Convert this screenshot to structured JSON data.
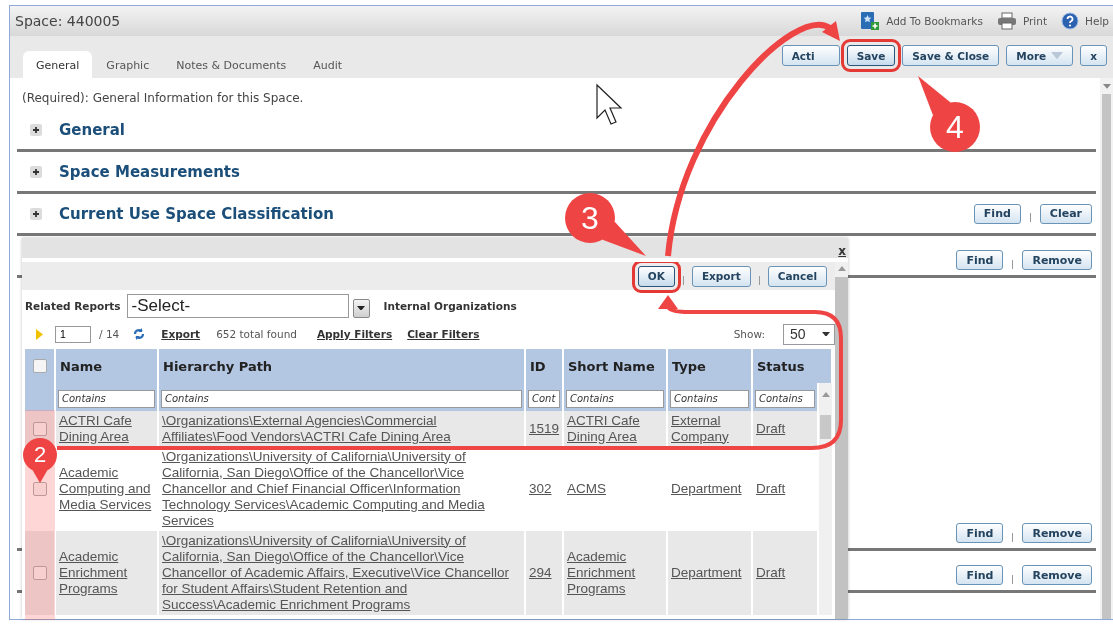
{
  "window": {
    "title": "Space: 440005"
  },
  "header_links": [
    {
      "kind": "bookmark",
      "label": "Add To Bookmarks"
    },
    {
      "kind": "print",
      "label": "Print"
    },
    {
      "kind": "help",
      "label": "Help"
    }
  ],
  "tabs": [
    {
      "label": "General",
      "selected": true
    },
    {
      "label": "Graphic",
      "selected": false
    },
    {
      "label": "Notes & Documents",
      "selected": false
    },
    {
      "label": "Audit",
      "selected": false
    }
  ],
  "toolbar_buttons": [
    {
      "label": "Acti",
      "highlighted": false,
      "dropdown": false
    },
    {
      "label": "Save",
      "highlighted": true,
      "dropdown": false
    },
    {
      "label": "Save & Close",
      "highlighted": false,
      "dropdown": false
    },
    {
      "label": "More",
      "highlighted": false,
      "dropdown": true
    },
    {
      "label": "x",
      "highlighted": false,
      "dropdown": false
    }
  ],
  "intro": "(Required): General Information for this Space.",
  "sections": [
    {
      "title": "General",
      "expanded": false
    },
    {
      "title": "Space Measurements",
      "expanded": false
    },
    {
      "title": "Current Use Space Classification",
      "expanded": false,
      "buttons": [
        "Find",
        "Clear"
      ]
    }
  ],
  "lower_rows": [
    {
      "buttons": [
        "Find",
        "Remove"
      ]
    },
    {
      "buttons": [
        "Find",
        "Remove"
      ]
    },
    {
      "buttons": [
        "Find",
        "Remove"
      ]
    }
  ],
  "dialog": {
    "close": "x",
    "buttons": [
      {
        "label": "OK",
        "highlighted": true
      },
      {
        "label": "Export",
        "highlighted": false
      },
      {
        "label": "Cancel",
        "highlighted": false
      }
    ],
    "related_reports": {
      "label": "Related Reports",
      "value": "-Select-"
    },
    "entity": "Internal Organizations",
    "pager": {
      "page": "1",
      "pages": "/ 14",
      "export": "Export",
      "total": "652 total found",
      "apply": "Apply Filters",
      "clear": "Clear Filters",
      "show_label": "Show:",
      "show_value": "50"
    },
    "table": {
      "select_all": {
        "checked": false
      },
      "columns": [
        {
          "label": "Name",
          "placeholder": "Contains"
        },
        {
          "label": "Hierarchy Path",
          "placeholder": "Contains"
        },
        {
          "label": "ID",
          "placeholder": "Cont"
        },
        {
          "label": "Short Name",
          "placeholder": "Contains"
        },
        {
          "label": "Type",
          "placeholder": "Contains"
        },
        {
          "label": "Status",
          "placeholder": "Contains"
        }
      ],
      "rows": [
        {
          "checked": false,
          "cells": [
            "ACTRI Cafe Dining Area",
            "\\Organizations\\External Agencies\\Commercial Affiliates\\Food Vendors\\ACTRI Cafe Dining Area",
            "1519",
            "ACTRI Cafe Dining Area",
            "External Company",
            "Draft"
          ]
        },
        {
          "checked": false,
          "cells": [
            "Academic Computing and Media Services",
            "\\Organizations\\University of California\\University of California, San Diego\\Office of the Chancellor\\Vice Chancellor and Chief Financial Officer\\Information Technology Services\\Academic Computing and Media Services",
            "302",
            "ACMS",
            "Department",
            "Draft"
          ]
        },
        {
          "checked": false,
          "cells": [
            "Academic Enrichment Programs",
            "\\Organizations\\University of California\\University of California, San Diego\\Office of the Chancellor\\Vice Chancellor of Academic Affairs, Executive\\Vice Chancellor for Student Affairs\\Student Retention and Success\\Academic Enrichment Programs",
            "294",
            "Academic Enrichment Programs",
            "Department",
            "Draft"
          ]
        }
      ]
    }
  },
  "annotations": [
    {
      "number": "2"
    },
    {
      "number": "3"
    },
    {
      "number": "4"
    }
  ]
}
